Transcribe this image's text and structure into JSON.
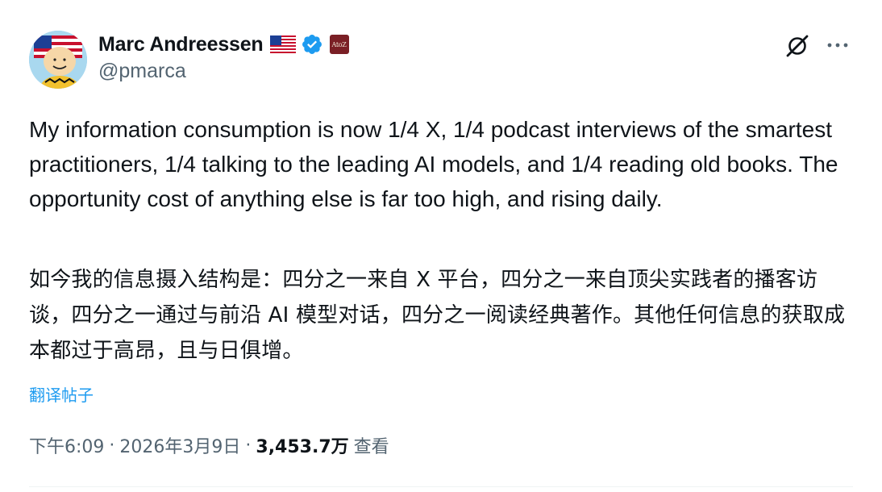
{
  "tweet": {
    "author": {
      "display_name": "Marc Andreessen",
      "handle": "@pmarca",
      "verified": true,
      "flag": "us-flag",
      "affiliate_badge": "AtoZ"
    },
    "text": "My information consumption is now 1/4 X, 1/4 podcast interviews of the smartest practitioners, 1/4 talking to the leading AI models, and 1/4 reading old books. The opportunity cost of anything else is far too high, and rising daily.",
    "translated_text": "如今我的信息摄入结构是：四分之一来自 X 平台，四分之一来自顶尖实践者的播客访谈，四分之一通过与前沿 AI 模型对话，四分之一阅读经典著作。其他任何信息的获取成本都过于高昂，且与日俱增。",
    "translate_label": "翻译帖子",
    "time": "下午6:09",
    "separator": "·",
    "date": "2026年3月9日",
    "views_count": "3,453.7万",
    "views_label": "查看"
  },
  "colors": {
    "text_primary": "#0f1419",
    "text_secondary": "#536471",
    "link": "#1d9bf0",
    "verified_badge": "#1d9bf0"
  },
  "icons": {
    "grok": "grok-icon",
    "more": "more-dots-icon",
    "verified": "verified-badge-icon"
  }
}
